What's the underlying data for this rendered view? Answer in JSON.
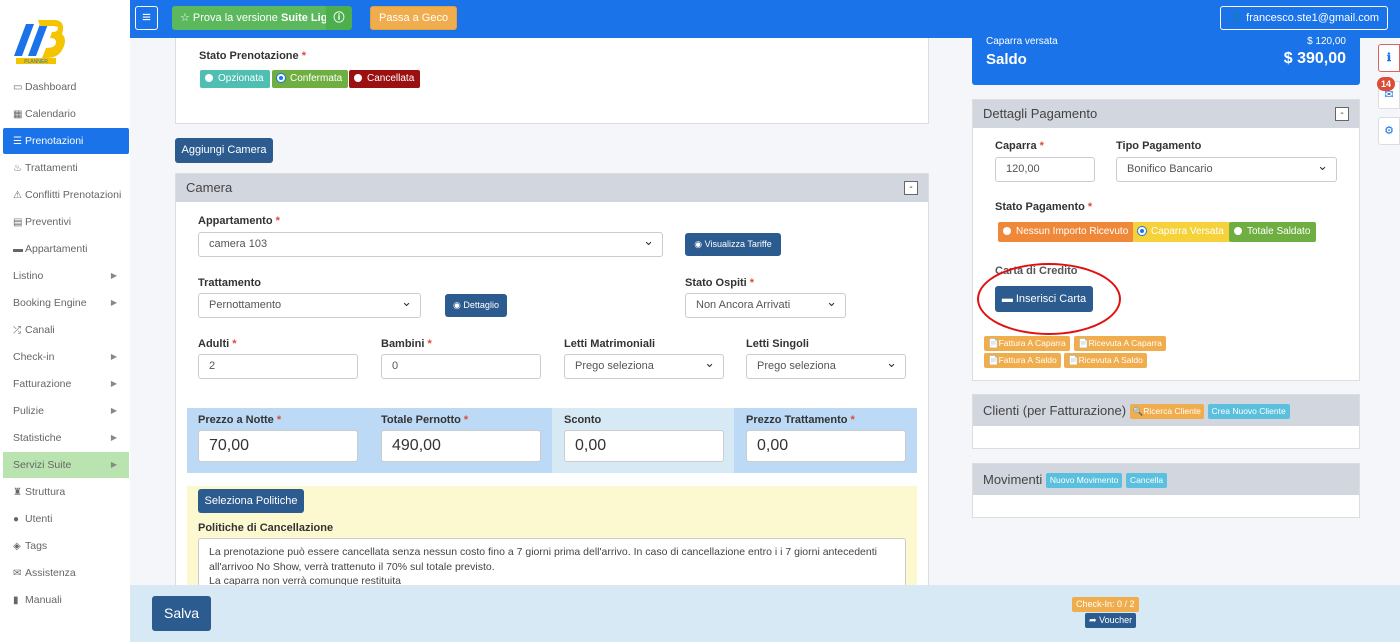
{
  "topbar": {
    "suite_label_pre": "Prova la versione",
    "suite_label_bold": "Suite Light",
    "geco_label": "Passa a Geco",
    "user_email": "francesco.ste1@gmail.com"
  },
  "brand": {
    "logo_text": "PLANNER",
    "accent": "#1a73e8"
  },
  "sidebar": {
    "items": [
      {
        "label": "Dashboard",
        "icon": "monitor-icon"
      },
      {
        "label": "Calendario",
        "icon": "calendar-icon"
      },
      {
        "label": "Prenotazioni",
        "icon": "list-icon",
        "active": true
      },
      {
        "label": "Trattamenti",
        "icon": "food-icon"
      },
      {
        "label": "Conflitti Prenotazioni",
        "icon": "warning-icon"
      },
      {
        "label": "Preventivi",
        "icon": "calculator-icon"
      },
      {
        "label": "Appartamenti",
        "icon": "bed-icon"
      },
      {
        "label": "Listino",
        "chevron": true
      },
      {
        "label": "Booking Engine",
        "chevron": true
      },
      {
        "label": "Canali",
        "icon": "shuffle-icon"
      },
      {
        "label": "Check-in",
        "chevron": true
      },
      {
        "label": "Fatturazione",
        "chevron": true
      },
      {
        "label": "Pulizie",
        "chevron": true
      },
      {
        "label": "Statistiche",
        "chevron": true
      },
      {
        "label": "Servizi Suite",
        "chevron": true,
        "highlight": true
      },
      {
        "label": "Struttura",
        "icon": "building-icon"
      },
      {
        "label": "Utenti",
        "icon": "user-icon"
      },
      {
        "label": "Tags",
        "icon": "tags-icon"
      },
      {
        "label": "Assistenza",
        "icon": "envelope-icon"
      },
      {
        "label": "Manuali",
        "icon": "book-icon"
      }
    ]
  },
  "stato_prenotazione": {
    "label": "Stato Prenotazione",
    "options": [
      "Opzionata",
      "Confermata",
      "Cancellata"
    ],
    "selected": "Confermata"
  },
  "aggiungi_camera_label": "Aggiungi Camera",
  "camera": {
    "title": "Camera",
    "collapse": "-",
    "appartamento_label": "Appartamento",
    "appartamento_value": "camera 103",
    "tariffe_label": "Visualizza Tariffe",
    "trattamento_label": "Trattamento",
    "trattamento_value": "Pernottamento",
    "dettaglio_label": "Dettaglio",
    "stato_ospiti_label": "Stato Ospiti",
    "stato_ospiti_value": "Non Ancora Arrivati",
    "adulti_label": "Adulti",
    "adulti_value": "2",
    "bambini_label": "Bambini",
    "bambini_value": "0",
    "letti_matrimoniali_label": "Letti Matrimoniali",
    "letti_matrimoniali_value": "Prego seleziona",
    "letti_singoli_label": "Letti Singoli",
    "letti_singoli_value": "Prego seleziona",
    "prezzo_notte_label": "Prezzo a Notte",
    "prezzo_notte_value": "70,00",
    "totale_pernotto_label": "Totale Pernotto",
    "totale_pernotto_value": "490,00",
    "sconto_label": "Sconto",
    "sconto_value": "0,00",
    "prezzo_trattamento_label": "Prezzo Trattamento",
    "prezzo_trattamento_value": "0,00",
    "politiche_button": "Seleziona Politiche",
    "politiche_label": "Politiche di Cancellazione",
    "politiche_line1": "La prenotazione può essere cancellata senza nessun costo fino a 7 giorni prima dell'arrivo. In caso di cancellazione entro i i 7 giorni antecedenti",
    "politiche_line2": "all'arrivoo No Show, verrà trattenuto il 70% sul totale previsto.",
    "politiche_line3": "La caparra non verrà comunque restituita"
  },
  "summary": {
    "caparra_label": "Caparra versata",
    "caparra_value": "$ 120,00",
    "saldo_label": "Saldo",
    "saldo_value": "$ 390,00"
  },
  "dettagli_pagamento": {
    "title": "Dettagli Pagamento",
    "caparra_label": "Caparra",
    "caparra_value": "120,00",
    "tipo_label": "Tipo Pagamento",
    "tipo_value": "Bonifico Bancario",
    "stato_label": "Stato Pagamento",
    "stato_options": [
      "Nessun Importo Ricevuto",
      "Caparra Versata",
      "Totale Saldato"
    ],
    "stato_selected": "Caparra Versata",
    "carta_label": "Carta di Credito",
    "inserisci_label": "Inserisci Carta",
    "docs": [
      "Fattura A Caparra",
      "Ricevuta A Caparra",
      "Fattura A Saldo",
      "Ricevuta A Saldo"
    ]
  },
  "clienti": {
    "title": "Clienti (per Fatturazione)",
    "ricerca_label": "Ricerca Cliente",
    "nuovo_label": "Crea Nuovo Cliente"
  },
  "movimenti": {
    "title": "Movimenti",
    "nuovo_label": "Nuovo Movimento",
    "cancella_label": "Cancella"
  },
  "right_tabs": {
    "notifications_count": "14"
  },
  "footer": {
    "salva_label": "Salva",
    "checkin_label": "Check-In: 0 / 2",
    "voucher_label": "Voucher"
  }
}
